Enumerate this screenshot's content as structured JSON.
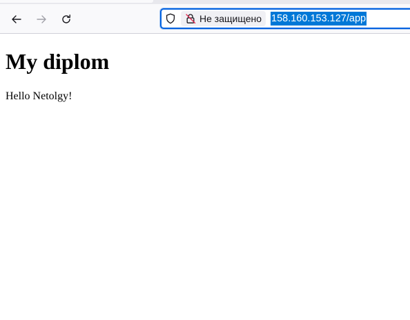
{
  "browser": {
    "toolbar": {
      "back_icon": "arrow-left-icon",
      "forward_icon": "arrow-right-icon",
      "reload_icon": "reload-icon"
    },
    "urlbar": {
      "tracking_icon": "shield-icon",
      "security_icon": "insecure-lock-icon",
      "security_label": "Не защищено",
      "url": "158.160.153.127/app",
      "focus_color": "#0061e0",
      "selection_color": "#0078d7"
    }
  },
  "page": {
    "heading": "My diplom",
    "text": "Hello Netolgy!"
  }
}
